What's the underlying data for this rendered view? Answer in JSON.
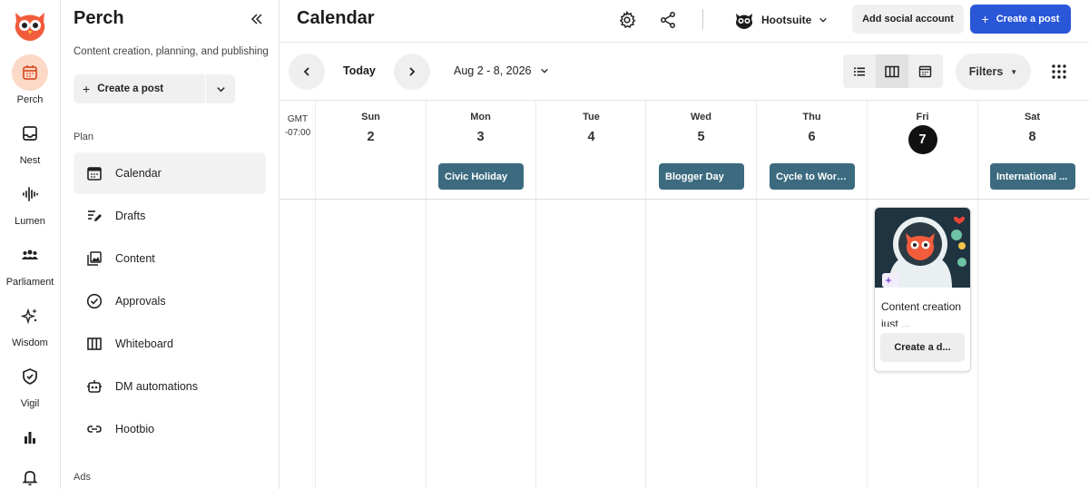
{
  "rail": {
    "items": [
      {
        "label": "Perch",
        "icon": "calendar-icon"
      },
      {
        "label": "Nest",
        "icon": "inbox-icon"
      },
      {
        "label": "Lumen",
        "icon": "waveform-icon"
      },
      {
        "label": "Parliament",
        "icon": "people-icon"
      },
      {
        "label": "Wisdom",
        "icon": "sparkles-icon"
      },
      {
        "label": "Vigil",
        "icon": "shield-icon"
      },
      {
        "label": "",
        "icon": "bar-chart-icon"
      },
      {
        "label": "",
        "icon": "bell-icon"
      }
    ],
    "accent": "#f25c3c"
  },
  "sidebar": {
    "title": "Perch",
    "subtitle": "Content creation, planning, and publishing",
    "create_label": "Create a post",
    "section_plan": "Plan",
    "section_ads": "Ads",
    "items": [
      {
        "label": "Calendar",
        "icon": "calendar-icon"
      },
      {
        "label": "Drafts",
        "icon": "drafts-icon"
      },
      {
        "label": "Content",
        "icon": "content-library-icon"
      },
      {
        "label": "Approvals",
        "icon": "check-circle-icon"
      },
      {
        "label": "Whiteboard",
        "icon": "whiteboard-icon"
      },
      {
        "label": "DM automations",
        "icon": "robot-icon"
      },
      {
        "label": "Hootbio",
        "icon": "link-icon"
      }
    ]
  },
  "header": {
    "title": "Calendar",
    "org_name": "Hootsuite",
    "add_social_label": "Add social account",
    "create_post_label": "Create a post",
    "primary_color": "#2a57d8"
  },
  "toolbar": {
    "today_label": "Today",
    "date_range": "Aug 2 - 8, 2026",
    "filters_label": "Filters"
  },
  "calendar": {
    "timezone": "GMT\n-07:00",
    "days": [
      {
        "name": "Sun",
        "num": "2",
        "event": ""
      },
      {
        "name": "Mon",
        "num": "3",
        "event": "Civic Holiday"
      },
      {
        "name": "Tue",
        "num": "4",
        "event": ""
      },
      {
        "name": "Wed",
        "num": "5",
        "event": "Blogger Day"
      },
      {
        "name": "Thu",
        "num": "6",
        "event": "Cycle to Work..."
      },
      {
        "name": "Fri",
        "num": "7",
        "event": ""
      },
      {
        "name": "Sat",
        "num": "8",
        "event": "International ..."
      }
    ],
    "today_index": 5,
    "event_color": "#3c6b80",
    "post_card": {
      "text": "Content creation just ...",
      "button_label": "Create a d..."
    }
  }
}
